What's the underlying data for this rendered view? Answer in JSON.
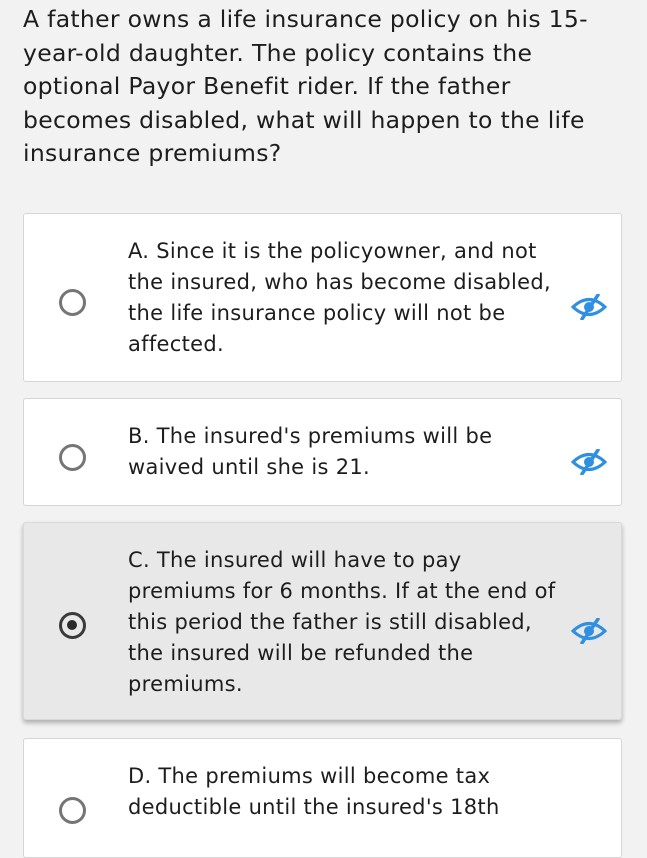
{
  "question": "A father owns a life insurance policy on his 15-year-old daughter. The policy contains the optional Payor Benefit rider. If the father becomes disabled, what will happen to the life insurance premiums?",
  "options": [
    {
      "label": "A. Since it is the policyowner, and not the insured, who has become disabled, the life insurance policy will not be affected.",
      "selected": false
    },
    {
      "label": "B. The insured's premiums will be waived until she is 21.",
      "selected": false
    },
    {
      "label": "C. The insured will have to pay premiums for 6 months. If at the end of this period the father is still disabled, the insured will be refunded the premiums.",
      "selected": true
    },
    {
      "label": "D. The premiums will become tax deductible until the insured's 18th",
      "selected": false
    }
  ],
  "icons": {
    "hide_option": "eye-slash-icon"
  },
  "colors": {
    "accent": "#2f8fe0",
    "selected_bg": "#e8e8e8"
  }
}
